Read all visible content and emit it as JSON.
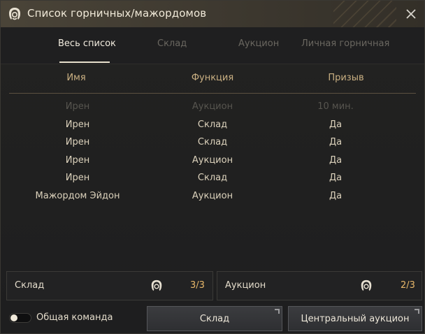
{
  "window": {
    "title": "Список горничных/мажордомов",
    "close_icon": "close-icon",
    "title_icon": "maid-icon"
  },
  "tabs": [
    {
      "label": "Весь список",
      "active": true
    },
    {
      "label": "Склад",
      "active": false
    },
    {
      "label": "Аукцион",
      "active": false
    },
    {
      "label": "Личная горничная",
      "active": false
    }
  ],
  "table": {
    "columns": [
      "Имя",
      "Функция",
      "Призыв"
    ],
    "rows": [
      {
        "name": "Ирен",
        "function": "Аукцион",
        "summon": "10 мин.",
        "dimmed": true
      },
      {
        "name": "Ирен",
        "function": "Склад",
        "summon": "Да",
        "dimmed": false
      },
      {
        "name": "Ирен",
        "function": "Склад",
        "summon": "Да",
        "dimmed": false
      },
      {
        "name": "Ирен",
        "function": "Аукцион",
        "summon": "Да",
        "dimmed": false
      },
      {
        "name": "Ирен",
        "function": "Склад",
        "summon": "Да",
        "dimmed": false
      },
      {
        "name": "Мажордом Эйдон",
        "function": "Аукцион",
        "summon": "Да",
        "dimmed": false
      }
    ]
  },
  "summary": {
    "storage": {
      "label": "Склад",
      "count": "3/3",
      "icon": "maid-icon"
    },
    "auction": {
      "label": "Аукцион",
      "count": "2/3",
      "icon": "maid-icon"
    }
  },
  "footer": {
    "toggle_label": "Общая команда",
    "toggle_on": false,
    "storage_button": "Склад",
    "auction_button": "Центральный аукцион"
  },
  "colors": {
    "accent_gold": "#cbb183",
    "count_orange": "#e9b86a"
  }
}
